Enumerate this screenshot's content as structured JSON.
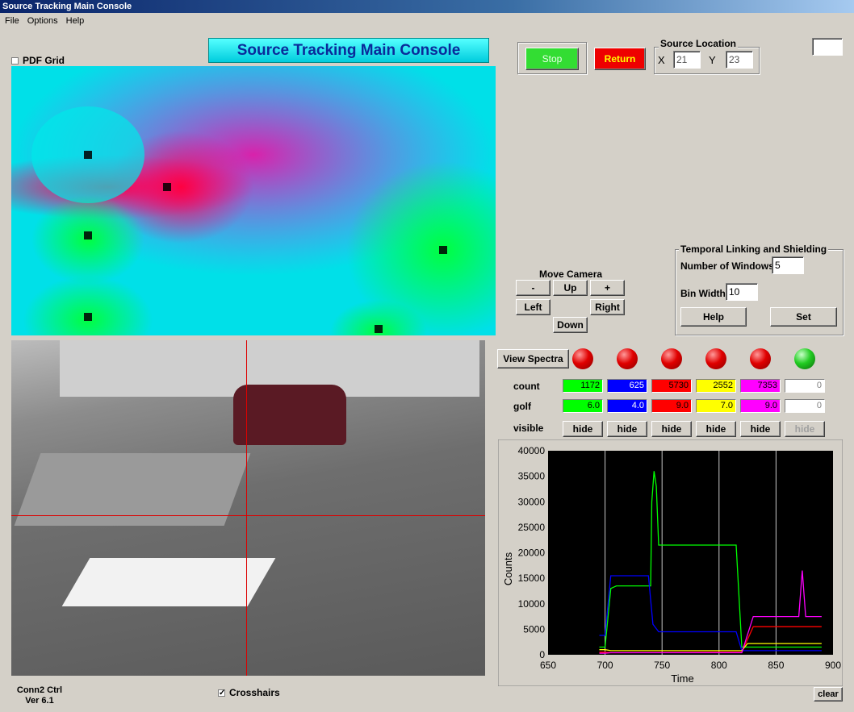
{
  "window": {
    "title": "Source Tracking Main Console"
  },
  "menu": [
    "File",
    "Options",
    "Help"
  ],
  "header": {
    "title": "Source Tracking Main Console"
  },
  "pdf_grid": {
    "label": "PDF Grid",
    "checked": false
  },
  "controls": {
    "stop": "Stop",
    "return": "Return"
  },
  "source_location": {
    "label": "Source Location",
    "x_label": "X",
    "x": "21",
    "y_label": "Y",
    "y": "23"
  },
  "camera": {
    "label": "Move Camera",
    "minus": "-",
    "up": "Up",
    "plus": "+",
    "left": "Left",
    "right": "Right",
    "down": "Down"
  },
  "temporal": {
    "label": "Temporal Linking and Shielding",
    "windows_label": "Number of Windows",
    "windows": "5",
    "bin_label": "Bin Width",
    "bin": "10",
    "help": "Help",
    "set": "Set"
  },
  "view_spectra": "View Spectra",
  "leds": [
    "red",
    "red",
    "red",
    "red",
    "red",
    "green"
  ],
  "table": {
    "count_label": "count",
    "golf_label": "golf",
    "visible_label": "visible",
    "hide_label": "hide",
    "count": [
      "1172",
      "625",
      "5730",
      "2552",
      "7353",
      "0"
    ],
    "golf": [
      "6.0",
      "4.0",
      "9.0",
      "7.0",
      "9.0",
      "0"
    ],
    "colors": [
      "#00ff00",
      "#0000ff",
      "#ff0000",
      "#ffff00",
      "#ff00ff",
      "#ffffff"
    ],
    "text_colors": [
      "#000000",
      "#ffffff",
      "#000000",
      "#000000",
      "#000000",
      "#808080"
    ]
  },
  "crosshairs": {
    "label": "Crosshairs",
    "checked": true
  },
  "footer": {
    "line1": "Conn2 Ctrl",
    "line2": "Ver 6.1"
  },
  "clear": "clear",
  "pdf_markers": [
    [
      95,
      110
    ],
    [
      95,
      210
    ],
    [
      95,
      311
    ],
    [
      193,
      150
    ],
    [
      535,
      228
    ],
    [
      455,
      326
    ]
  ],
  "camera_placeholder": "camera view",
  "chart_data": {
    "type": "line",
    "xlabel": "Time",
    "ylabel": "Counts",
    "xlim": [
      650,
      900
    ],
    "ylim": [
      0,
      40000
    ],
    "xticks": [
      650,
      700,
      750,
      800,
      850,
      900
    ],
    "yticks": [
      0,
      5000,
      10000,
      15000,
      20000,
      25000,
      30000,
      35000,
      40000
    ],
    "vlines": [
      700,
      750,
      800,
      850
    ],
    "series": [
      {
        "color": "#00ff00",
        "points": [
          [
            695,
            1500
          ],
          [
            700,
            1500
          ],
          [
            705,
            13000
          ],
          [
            710,
            13500
          ],
          [
            740,
            13500
          ],
          [
            741,
            30000
          ],
          [
            743,
            36000
          ],
          [
            745,
            33000
          ],
          [
            747,
            21500
          ],
          [
            760,
            21500
          ],
          [
            815,
            21500
          ],
          [
            820,
            1500
          ],
          [
            890,
            1500
          ]
        ]
      },
      {
        "color": "#0000ff",
        "points": [
          [
            695,
            3800
          ],
          [
            700,
            3800
          ],
          [
            705,
            15500
          ],
          [
            738,
            15500
          ],
          [
            742,
            6000
          ],
          [
            747,
            4500
          ],
          [
            815,
            4500
          ],
          [
            820,
            800
          ],
          [
            890,
            800
          ]
        ]
      },
      {
        "color": "#ff0000",
        "points": [
          [
            695,
            500
          ],
          [
            700,
            500
          ],
          [
            705,
            400
          ],
          [
            820,
            500
          ],
          [
            830,
            5500
          ],
          [
            890,
            5500
          ]
        ]
      },
      {
        "color": "#ffff00",
        "points": [
          [
            695,
            1000
          ],
          [
            700,
            1000
          ],
          [
            705,
            800
          ],
          [
            820,
            800
          ],
          [
            825,
            2200
          ],
          [
            890,
            2200
          ]
        ]
      },
      {
        "color": "#ff00ff",
        "points": [
          [
            695,
            300
          ],
          [
            700,
            300
          ],
          [
            705,
            400
          ],
          [
            820,
            400
          ],
          [
            830,
            7500
          ],
          [
            870,
            7500
          ],
          [
            873,
            16500
          ],
          [
            876,
            7500
          ],
          [
            890,
            7500
          ]
        ]
      }
    ]
  }
}
